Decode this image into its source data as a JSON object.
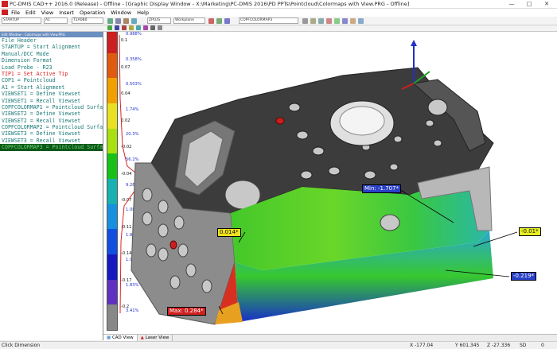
{
  "window": {
    "title": "PC-DMIS CAD++ 2016.0 (Release) - Offline - [Graphic Display Window - X:\\Marketing\\PC-DMIS 2016\\PD PPTs\\Pointcloud\\Colormaps with View.PRG - Offline]"
  },
  "menu": [
    "File",
    "Edit",
    "View",
    "Insert",
    "Operation",
    "Window",
    "Help"
  ],
  "toolbar": {
    "combo1": "STARTUP",
    "combo2": "A1",
    "combo3": "T1A0B0",
    "combo4": "ZPLUS",
    "combo5": "Workplane",
    "combo6": "COPFCOLORMAP3"
  },
  "edit_window": {
    "header": "Edit Window - Colormaps with View.PRG",
    "lines": [
      {
        "text": "File Header",
        "color": "#1a7a78"
      },
      {
        "text": "STARTUP = Start Alignment",
        "color": "#1a7a78"
      },
      {
        "text": "Manual/DCC Mode",
        "color": "#1a7a78"
      },
      {
        "text": "Dimension Format",
        "color": "#1a7a78"
      },
      {
        "text": "Load Probe - R23",
        "color": "#1a7a78"
      },
      {
        "text": "TIP1 = Set Active Tip",
        "color": "#e02020"
      },
      {
        "text": "COP1 = Pointcloud",
        "color": "#1a7a78"
      },
      {
        "text": "A1 = Start Alignment",
        "color": "#1a7a78"
      },
      {
        "text": "VIEWSET1 = Define Viewset",
        "color": "#1a7a78"
      },
      {
        "text": "VIEWSET1 = Recall Viewset",
        "color": "#1a7a78"
      },
      {
        "text": "COPFCOLORMAP1 = Pointcloud Surface",
        "color": "#1a7a78"
      },
      {
        "text": "VIEWSET2 = Define Viewset",
        "color": "#1a7a78"
      },
      {
        "text": "VIEWSET2 = Recall Viewset",
        "color": "#1a7a78"
      },
      {
        "text": "COPFCOLORMAP2 = Pointcloud Surface",
        "color": "#1a7a78"
      },
      {
        "text": "VIEWSET3 = Define Viewset",
        "color": "#1a7a78"
      },
      {
        "text": "VIEWSET3 = Recall Viewset",
        "color": "#1a7a78"
      },
      {
        "text": "COPFCOLORMAP3 = Pointcloud Surface",
        "color": "#6fd06f",
        "highlight": true
      }
    ]
  },
  "scale": {
    "values": [
      "0.1",
      "0.07",
      "0.04",
      "0.02",
      "-0.02",
      "-0.04",
      "-0.07",
      "-0.11",
      "-0.14",
      "-0.17",
      "-0.2"
    ],
    "percents": [
      "0.988%",
      "0.358%",
      "0.503%",
      "1.74%",
      "20.3%",
      "56.2%",
      "9.26%",
      "1.08%",
      "1.87%",
      "1.91%",
      "1.83%",
      "3.41%"
    ],
    "colors": [
      "#cc2020",
      "#e05a10",
      "#f0a000",
      "#e8e020",
      "#a8e010",
      "#18c018",
      "#18b0b0",
      "#1890e0",
      "#1050e0",
      "#1818c0",
      "#6030c0",
      "#888888"
    ]
  },
  "callouts": {
    "min": "Min: -1.707*",
    "max": "Max: 0.284*",
    "v1": "0.014*",
    "v2": "-0.01*",
    "v3": "-0.219*"
  },
  "view_tabs": [
    "CAD View",
    "Laser View"
  ],
  "status": {
    "left": "Click Dimension",
    "x": "X -177.04",
    "y": "Y 601.345",
    "z": "Z -27.336",
    "sd": "SD",
    "sd_val": "0"
  }
}
